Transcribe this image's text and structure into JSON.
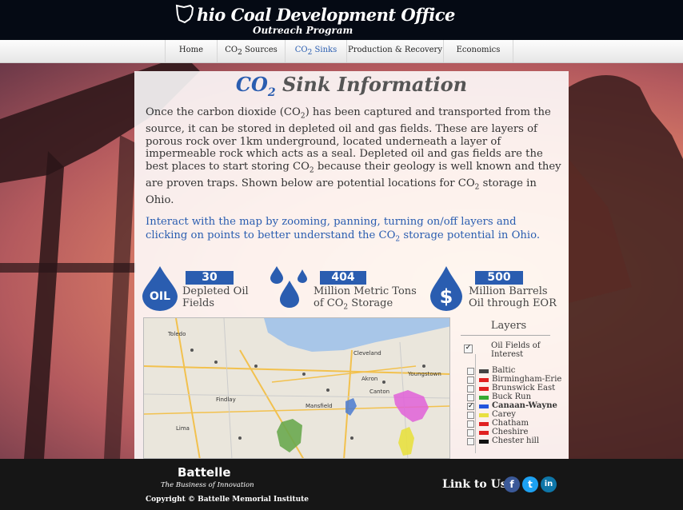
{
  "header": {
    "logo_prefix": "hio",
    "logo_title": " Coal Development Office",
    "logo_subtitle": "Outreach Program"
  },
  "nav": {
    "items": [
      {
        "label": "Home",
        "active": false
      },
      {
        "label_main": "CO",
        "label_sub": "2",
        "label_rest": " Sources",
        "active": false
      },
      {
        "label_main": "CO",
        "label_sub": "2",
        "label_rest": " Sinks",
        "active": true
      },
      {
        "label": "Production & Recovery",
        "active": false
      },
      {
        "label": "Economics",
        "active": false
      }
    ]
  },
  "main": {
    "title_co": "CO",
    "title_sub": "2",
    "title_rest": " Sink Information",
    "intro_1": "Once the carbon dioxide (CO",
    "intro_2": ") has been captured and  transported from the source, it can be stored in depleted oil and gas fields. These are layers of porous rock over 1km underground, located underneath a layer of impermeable rock which acts as a seal. Depleted oil and gas fields are the best places to start storing CO",
    "intro_3": " because their geology is well known and they are proven traps. Shown below are potential locations for CO",
    "intro_4": " storage in Ohio.",
    "sub2": "2",
    "interact_1": "Interact with the map by zooming, panning, turning on/off layers and clicking on points to better understand the CO",
    "interact_2": " storage potential in Ohio."
  },
  "stats": [
    {
      "value": "30",
      "label_1": "Depleted Oil",
      "label_2": "Fields",
      "icon": "oil-drop-icon",
      "icon_text": "OIL"
    },
    {
      "value": "404",
      "label_1": "Million Metric Tons",
      "label_2a": "of CO",
      "label_2sub": "2",
      "label_2b": " Storage",
      "icon": "water-drops-icon"
    },
    {
      "value": "500",
      "label_1": "Million Barrels",
      "label_2": "Oil through EOR",
      "icon": "dollar-drop-icon",
      "icon_text": "$"
    }
  ],
  "map": {
    "city_labels": [
      "Cleveland",
      "Akron",
      "Canton",
      "Mansfield",
      "Findlay",
      "Lima",
      "Youngstown",
      "Toledo"
    ]
  },
  "layers": {
    "title": "Layers",
    "group_label_1": "Oil Fields of",
    "group_label_2": "Interest",
    "group_checked": true,
    "items": [
      {
        "name": "Baltic",
        "color": "#444444",
        "checked": false
      },
      {
        "name": "Birmingham-Erie",
        "color": "#e02020",
        "checked": false
      },
      {
        "name": "Brunswick East",
        "color": "#e02020",
        "checked": false
      },
      {
        "name": "Buck Run",
        "color": "#33aa33",
        "checked": false
      },
      {
        "name": "Canaan-Wayne",
        "color": "#2255dd",
        "checked": true
      },
      {
        "name": "Carey",
        "color": "#e8e040",
        "checked": false
      },
      {
        "name": "Chatham",
        "color": "#e02020",
        "checked": false
      },
      {
        "name": "Cheshire",
        "color": "#e02020",
        "checked": false
      },
      {
        "name": "Chester hill",
        "color": "#111111",
        "checked": false
      }
    ]
  },
  "footer": {
    "brand": "Battelle",
    "tagline": "The Business of Innovation",
    "copyright": "Copyright © Battelle Memorial Institute",
    "link_to": "Link to Us:"
  },
  "colors": {
    "accent": "#2a5db0",
    "header_bg": "#050a14",
    "footer_bg": "#161616"
  }
}
